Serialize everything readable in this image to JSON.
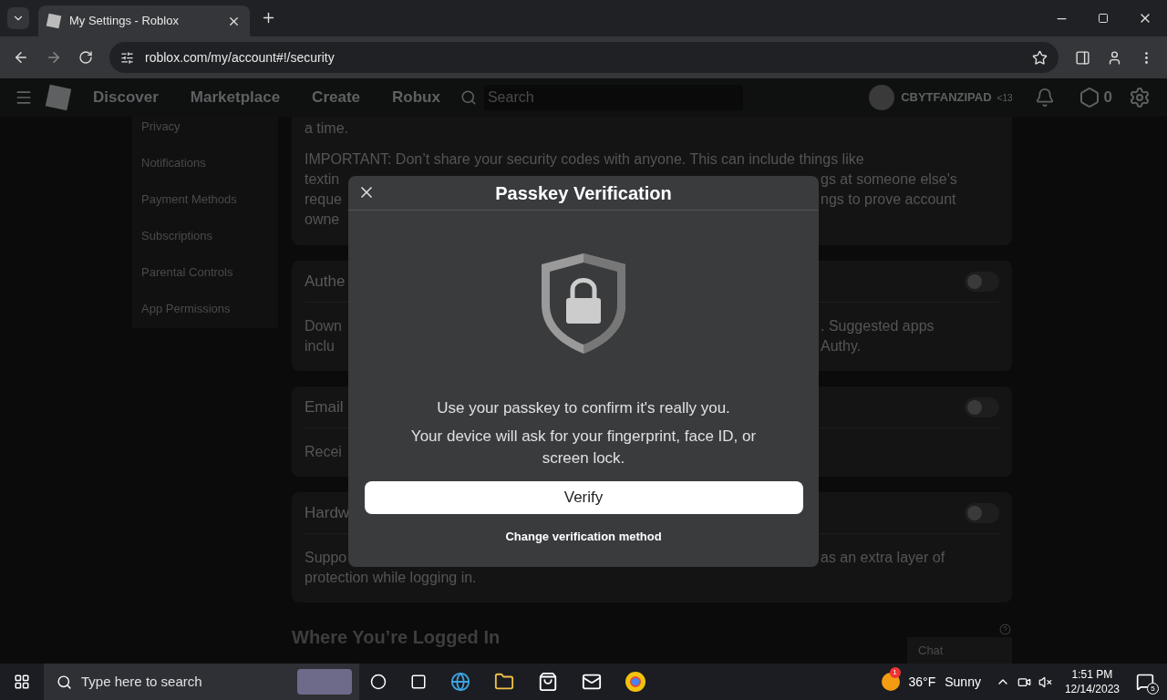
{
  "browser": {
    "tab_title": "My Settings - Roblox",
    "url": "roblox.com/my/account#!/security"
  },
  "nav": {
    "items": [
      "Discover",
      "Marketplace",
      "Create",
      "Robux"
    ],
    "search_placeholder": "Search",
    "username": "CBYTFANZIPAD",
    "age_tag": "<13",
    "robux": "0"
  },
  "sidebar": {
    "items": [
      "Privacy",
      "Notifications",
      "Payment Methods",
      "Subscriptions",
      "Parental Controls",
      "App Permissions"
    ]
  },
  "content": {
    "intro_lines": [
      "a time.",
      "IMPORTANT: Don’t share your security codes with anyone. This can include things like"
    ],
    "intro_fragments": [
      {
        "left": "textin",
        "right": "gs at someone else's"
      },
      {
        "left": "reque",
        "right": "ngs to prove account"
      },
      {
        "left": "owne"
      }
    ],
    "cards": [
      {
        "title": "Authe",
        "on": false,
        "lines": [
          {
            "left": "Down",
            "right": ". Suggested apps"
          },
          {
            "left": "inclu",
            "right": "Authy."
          }
        ]
      },
      {
        "title": "Email",
        "on": false,
        "lines": [
          {
            "left": "Recei"
          }
        ]
      },
      {
        "title": "Hardw",
        "on": false,
        "lines": [
          {
            "left": "Suppo",
            "right": "as an extra layer of"
          }
        ],
        "trailing": "protection while logging in."
      }
    ],
    "section_heading": "Where You’re Logged In",
    "chat": "Chat"
  },
  "modal": {
    "title": "Passkey Verification",
    "message": "Use your passkey to confirm it's really you.",
    "detail": "Your device will ask for your fingerprint, face ID, or screen lock.",
    "primary_button": "Verify",
    "link": "Change verification method"
  },
  "taskbar": {
    "search_placeholder": "Type here to search",
    "weather_badge": "1",
    "temperature": "36°F",
    "condition": "Sunny",
    "time": "1:51 PM",
    "date": "12/14/2023",
    "notifications": "5"
  }
}
